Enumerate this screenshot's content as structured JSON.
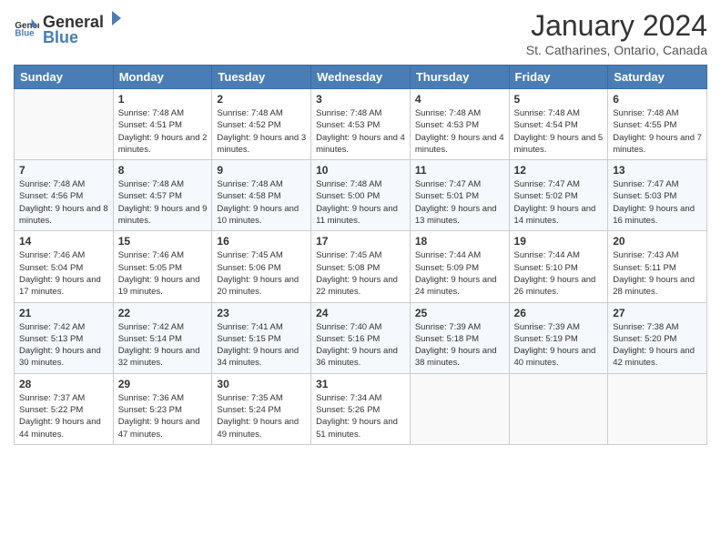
{
  "logo": {
    "general": "General",
    "blue": "Blue"
  },
  "header": {
    "month": "January 2024",
    "location": "St. Catharines, Ontario, Canada"
  },
  "weekdays": [
    "Sunday",
    "Monday",
    "Tuesday",
    "Wednesday",
    "Thursday",
    "Friday",
    "Saturday"
  ],
  "weeks": [
    [
      {
        "day": "",
        "sunrise": "",
        "sunset": "",
        "daylight": ""
      },
      {
        "day": "1",
        "sunrise": "Sunrise: 7:48 AM",
        "sunset": "Sunset: 4:51 PM",
        "daylight": "Daylight: 9 hours and 2 minutes."
      },
      {
        "day": "2",
        "sunrise": "Sunrise: 7:48 AM",
        "sunset": "Sunset: 4:52 PM",
        "daylight": "Daylight: 9 hours and 3 minutes."
      },
      {
        "day": "3",
        "sunrise": "Sunrise: 7:48 AM",
        "sunset": "Sunset: 4:53 PM",
        "daylight": "Daylight: 9 hours and 4 minutes."
      },
      {
        "day": "4",
        "sunrise": "Sunrise: 7:48 AM",
        "sunset": "Sunset: 4:53 PM",
        "daylight": "Daylight: 9 hours and 4 minutes."
      },
      {
        "day": "5",
        "sunrise": "Sunrise: 7:48 AM",
        "sunset": "Sunset: 4:54 PM",
        "daylight": "Daylight: 9 hours and 5 minutes."
      },
      {
        "day": "6",
        "sunrise": "Sunrise: 7:48 AM",
        "sunset": "Sunset: 4:55 PM",
        "daylight": "Daylight: 9 hours and 7 minutes."
      }
    ],
    [
      {
        "day": "7",
        "sunrise": "Sunrise: 7:48 AM",
        "sunset": "Sunset: 4:56 PM",
        "daylight": "Daylight: 9 hours and 8 minutes."
      },
      {
        "day": "8",
        "sunrise": "Sunrise: 7:48 AM",
        "sunset": "Sunset: 4:57 PM",
        "daylight": "Daylight: 9 hours and 9 minutes."
      },
      {
        "day": "9",
        "sunrise": "Sunrise: 7:48 AM",
        "sunset": "Sunset: 4:58 PM",
        "daylight": "Daylight: 9 hours and 10 minutes."
      },
      {
        "day": "10",
        "sunrise": "Sunrise: 7:48 AM",
        "sunset": "Sunset: 5:00 PM",
        "daylight": "Daylight: 9 hours and 11 minutes."
      },
      {
        "day": "11",
        "sunrise": "Sunrise: 7:47 AM",
        "sunset": "Sunset: 5:01 PM",
        "daylight": "Daylight: 9 hours and 13 minutes."
      },
      {
        "day": "12",
        "sunrise": "Sunrise: 7:47 AM",
        "sunset": "Sunset: 5:02 PM",
        "daylight": "Daylight: 9 hours and 14 minutes."
      },
      {
        "day": "13",
        "sunrise": "Sunrise: 7:47 AM",
        "sunset": "Sunset: 5:03 PM",
        "daylight": "Daylight: 9 hours and 16 minutes."
      }
    ],
    [
      {
        "day": "14",
        "sunrise": "Sunrise: 7:46 AM",
        "sunset": "Sunset: 5:04 PM",
        "daylight": "Daylight: 9 hours and 17 minutes."
      },
      {
        "day": "15",
        "sunrise": "Sunrise: 7:46 AM",
        "sunset": "Sunset: 5:05 PM",
        "daylight": "Daylight: 9 hours and 19 minutes."
      },
      {
        "day": "16",
        "sunrise": "Sunrise: 7:45 AM",
        "sunset": "Sunset: 5:06 PM",
        "daylight": "Daylight: 9 hours and 20 minutes."
      },
      {
        "day": "17",
        "sunrise": "Sunrise: 7:45 AM",
        "sunset": "Sunset: 5:08 PM",
        "daylight": "Daylight: 9 hours and 22 minutes."
      },
      {
        "day": "18",
        "sunrise": "Sunrise: 7:44 AM",
        "sunset": "Sunset: 5:09 PM",
        "daylight": "Daylight: 9 hours and 24 minutes."
      },
      {
        "day": "19",
        "sunrise": "Sunrise: 7:44 AM",
        "sunset": "Sunset: 5:10 PM",
        "daylight": "Daylight: 9 hours and 26 minutes."
      },
      {
        "day": "20",
        "sunrise": "Sunrise: 7:43 AM",
        "sunset": "Sunset: 5:11 PM",
        "daylight": "Daylight: 9 hours and 28 minutes."
      }
    ],
    [
      {
        "day": "21",
        "sunrise": "Sunrise: 7:42 AM",
        "sunset": "Sunset: 5:13 PM",
        "daylight": "Daylight: 9 hours and 30 minutes."
      },
      {
        "day": "22",
        "sunrise": "Sunrise: 7:42 AM",
        "sunset": "Sunset: 5:14 PM",
        "daylight": "Daylight: 9 hours and 32 minutes."
      },
      {
        "day": "23",
        "sunrise": "Sunrise: 7:41 AM",
        "sunset": "Sunset: 5:15 PM",
        "daylight": "Daylight: 9 hours and 34 minutes."
      },
      {
        "day": "24",
        "sunrise": "Sunrise: 7:40 AM",
        "sunset": "Sunset: 5:16 PM",
        "daylight": "Daylight: 9 hours and 36 minutes."
      },
      {
        "day": "25",
        "sunrise": "Sunrise: 7:39 AM",
        "sunset": "Sunset: 5:18 PM",
        "daylight": "Daylight: 9 hours and 38 minutes."
      },
      {
        "day": "26",
        "sunrise": "Sunrise: 7:39 AM",
        "sunset": "Sunset: 5:19 PM",
        "daylight": "Daylight: 9 hours and 40 minutes."
      },
      {
        "day": "27",
        "sunrise": "Sunrise: 7:38 AM",
        "sunset": "Sunset: 5:20 PM",
        "daylight": "Daylight: 9 hours and 42 minutes."
      }
    ],
    [
      {
        "day": "28",
        "sunrise": "Sunrise: 7:37 AM",
        "sunset": "Sunset: 5:22 PM",
        "daylight": "Daylight: 9 hours and 44 minutes."
      },
      {
        "day": "29",
        "sunrise": "Sunrise: 7:36 AM",
        "sunset": "Sunset: 5:23 PM",
        "daylight": "Daylight: 9 hours and 47 minutes."
      },
      {
        "day": "30",
        "sunrise": "Sunrise: 7:35 AM",
        "sunset": "Sunset: 5:24 PM",
        "daylight": "Daylight: 9 hours and 49 minutes."
      },
      {
        "day": "31",
        "sunrise": "Sunrise: 7:34 AM",
        "sunset": "Sunset: 5:26 PM",
        "daylight": "Daylight: 9 hours and 51 minutes."
      },
      {
        "day": "",
        "sunrise": "",
        "sunset": "",
        "daylight": ""
      },
      {
        "day": "",
        "sunrise": "",
        "sunset": "",
        "daylight": ""
      },
      {
        "day": "",
        "sunrise": "",
        "sunset": "",
        "daylight": ""
      }
    ]
  ]
}
